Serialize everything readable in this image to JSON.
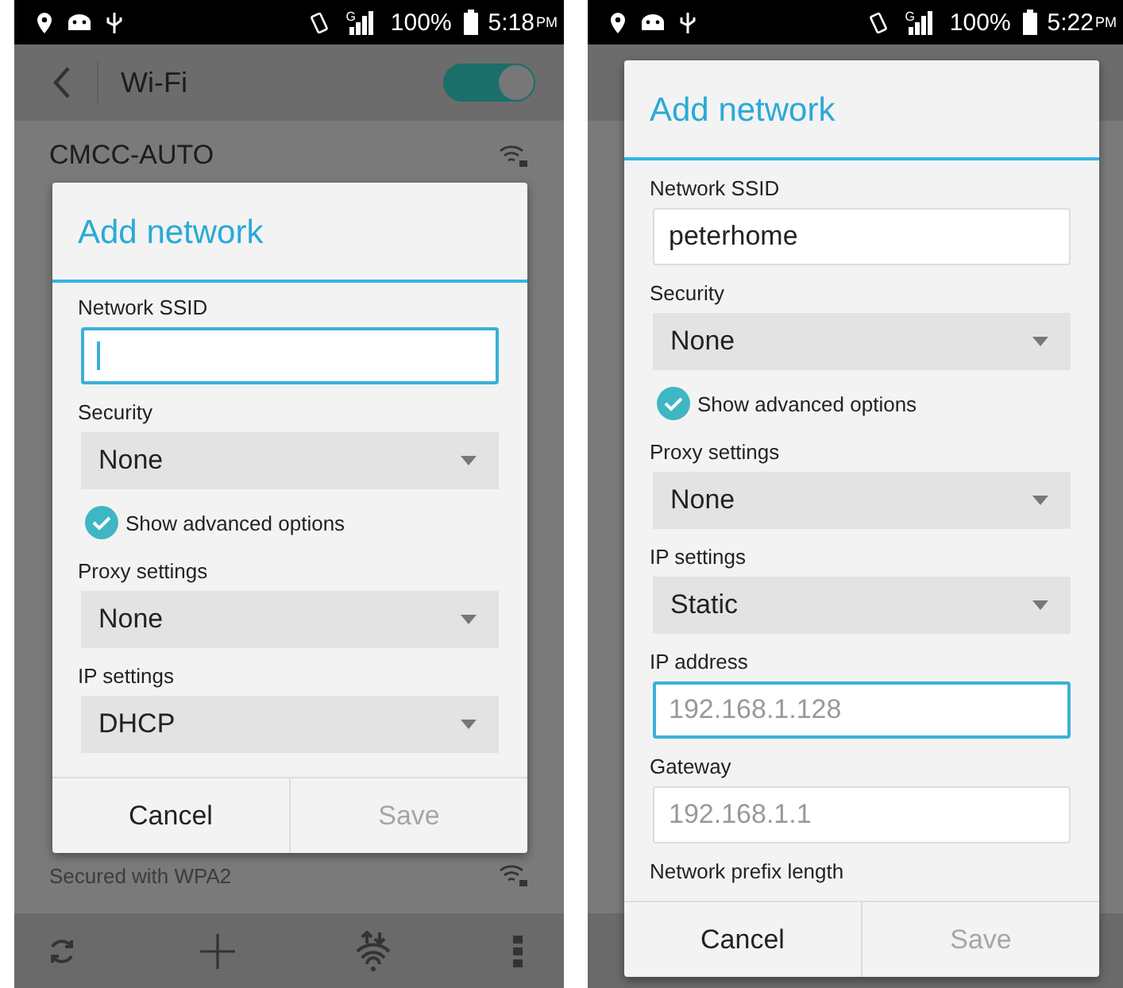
{
  "screens": [
    {
      "status_bar": {
        "network": "G",
        "battery": "100%",
        "time": "5:18",
        "ampm": "PM"
      },
      "app_bar": {
        "title": "Wi-Fi",
        "wifi_on": true
      },
      "networks": [
        {
          "name": "CMCC-AUTO"
        },
        {
          "subtitle": "Secured with WPA2"
        }
      ],
      "dialog": {
        "title": "Add network",
        "fields": [
          {
            "kind": "text",
            "label": "Network SSID",
            "focused": true
          },
          {
            "kind": "select",
            "label": "Security",
            "value": "None"
          },
          {
            "kind": "checkbox",
            "label": "Show advanced options",
            "checked": true
          },
          {
            "kind": "select",
            "label": "Proxy settings",
            "value": "None"
          },
          {
            "kind": "select",
            "label": "IP settings",
            "value": "DHCP"
          }
        ],
        "buttons": [
          {
            "label": "Cancel",
            "disabled": false
          },
          {
            "label": "Save",
            "disabled": true
          }
        ]
      }
    },
    {
      "status_bar": {
        "network": "G",
        "battery": "100%",
        "time": "5:22",
        "ampm": "PM"
      },
      "dialog": {
        "title": "Add network",
        "fields": [
          {
            "kind": "text",
            "label": "Network SSID",
            "value": "peterhome",
            "focused": false
          },
          {
            "kind": "select",
            "label": "Security",
            "value": "None"
          },
          {
            "kind": "checkbox",
            "label": "Show advanced options",
            "checked": true
          },
          {
            "kind": "select",
            "label": "Proxy settings",
            "value": "None"
          },
          {
            "kind": "select",
            "label": "IP settings",
            "value": "Static"
          },
          {
            "kind": "text",
            "label": "IP address",
            "placeholder": "192.168.1.128",
            "focused": true
          },
          {
            "kind": "text",
            "label": "Gateway",
            "placeholder": "192.168.1.1",
            "focused": false
          },
          {
            "kind": "label",
            "label": "Network prefix length"
          }
        ],
        "buttons": [
          {
            "label": "Cancel",
            "disabled": false
          },
          {
            "label": "Save",
            "disabled": true
          }
        ]
      }
    }
  ]
}
